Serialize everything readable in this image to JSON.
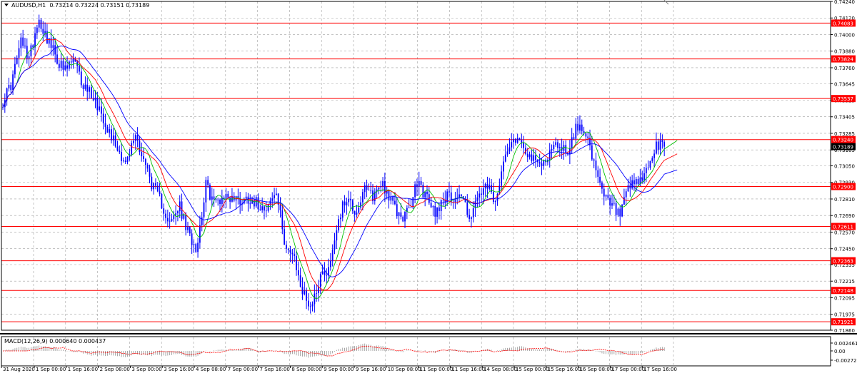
{
  "header": {
    "symbol": "AUDUSD,H1",
    "ohlc": "0.73214 0.73224 0.73151 0.73189"
  },
  "macd": {
    "label": "MACD(12,26,9) 0.000640 0.000437",
    "axis_labels": [
      "0.002461",
      "0.00",
      "-0.002723"
    ]
  },
  "chart_data": {
    "type": "candlestick",
    "title": "AUDUSD,H1",
    "ylim": [
      0.7186,
      0.7424
    ],
    "y_tick_labels": [
      "0.74240",
      "0.74120",
      "0.74000",
      "0.73880",
      "0.73760",
      "0.73645",
      "0.73525",
      "0.73405",
      "0.73285",
      "0.73165",
      "0.73050",
      "0.72930",
      "0.72810",
      "0.72690",
      "0.72570",
      "0.72450",
      "0.72335",
      "0.72215",
      "0.72095",
      "0.71975",
      "0.71860"
    ],
    "x_tick_labels": [
      "31 Aug 2020",
      "1 Sep 00:00",
      "1 Sep 16:00",
      "2 Sep 08:00",
      "3 Sep 00:00",
      "3 Sep 16:00",
      "4 Sep 08:00",
      "7 Sep 00:00",
      "7 Sep 16:00",
      "8 Sep 08:00",
      "9 Sep 00:00",
      "9 Sep 16:00",
      "10 Sep 08:00",
      "11 Sep 00:00",
      "11 Sep 16:00",
      "14 Sep 08:00",
      "15 Sep 00:00",
      "15 Sep 16:00",
      "16 Sep 08:00",
      "17 Sep 00:00",
      "17 Sep 16:00"
    ],
    "horizontal_levels": [
      "0.74083",
      "0.73824",
      "0.73537",
      "0.73240",
      "0.72900",
      "0.72611",
      "0.72363",
      "0.72148",
      "0.71921"
    ],
    "current_price": "0.73189",
    "price_path": [
      0.7352,
      0.7365,
      0.7395,
      0.7383,
      0.7412,
      0.7398,
      0.7384,
      0.7373,
      0.7382,
      0.7364,
      0.7358,
      0.7346,
      0.7331,
      0.7318,
      0.7306,
      0.7328,
      0.7309,
      0.729,
      0.7278,
      0.7262,
      0.7276,
      0.7256,
      0.7246,
      0.7291,
      0.7278,
      0.7283,
      0.7282,
      0.728,
      0.7282,
      0.7277,
      0.7276,
      0.7285,
      0.7249,
      0.7237,
      0.7213,
      0.7203,
      0.7226,
      0.7231,
      0.7266,
      0.7283,
      0.7271,
      0.7287,
      0.7283,
      0.7294,
      0.7279,
      0.7268,
      0.7271,
      0.7294,
      0.7282,
      0.7271,
      0.7283,
      0.7282,
      0.7284,
      0.7267,
      0.7284,
      0.7289,
      0.7277,
      0.7318,
      0.7326,
      0.7321,
      0.7309,
      0.7305,
      0.7315,
      0.7321,
      0.7315,
      0.7332,
      0.7333,
      0.7305,
      0.7284,
      0.7276,
      0.7269,
      0.7289,
      0.7292,
      0.7301,
      0.7318,
      0.732
    ],
    "series": [
      {
        "name": "MA green",
        "color": "#00c000"
      },
      {
        "name": "MA red",
        "color": "#ff0000"
      },
      {
        "name": "MA blue",
        "color": "#0000ff"
      }
    ]
  },
  "colors": {
    "candle": "#0000ff",
    "level_line": "#ff0000",
    "level_label_bg": "#ff0000",
    "grid": "#a0a0a0",
    "macd_signal": "#ff0000",
    "macd_hist": "#909090",
    "current_label_bg": "#000000"
  }
}
